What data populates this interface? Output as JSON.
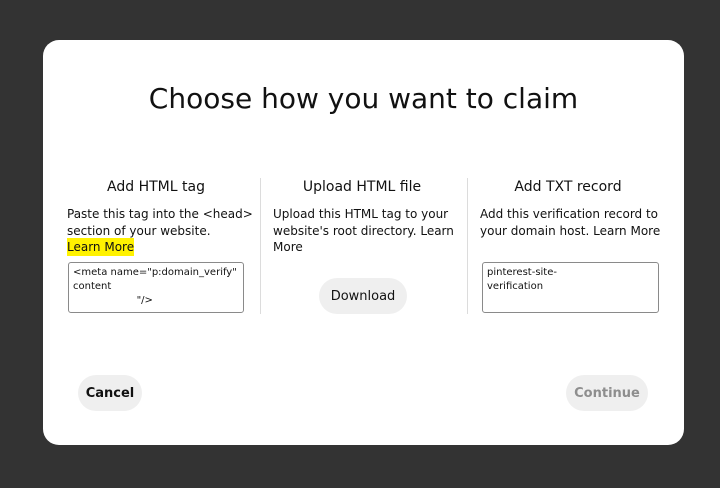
{
  "modal": {
    "title": "Choose how you want to claim"
  },
  "options": [
    {
      "heading": "Add HTML tag",
      "description": "Paste this tag into the <head> section of your website.",
      "link": "Learn More",
      "field_value": "<meta name=\"p:domain_verify\"\ncontent\n                    \"/>"
    },
    {
      "heading": "Upload HTML file",
      "description": "Upload this HTML tag to your website's root directory.",
      "link": "Learn More",
      "button": "Download"
    },
    {
      "heading": "Add TXT record",
      "description": "Add this verification record to your domain host.",
      "link": "Learn More",
      "field_value": "pinterest-site-\nverification"
    }
  ],
  "footer": {
    "cancel_label": "Cancel",
    "continue_label": "Continue"
  },
  "colors": {
    "backdrop": "#333333",
    "highlight": "#fff200",
    "button_bg": "#efefef",
    "disabled_text": "#8e8e8e"
  }
}
